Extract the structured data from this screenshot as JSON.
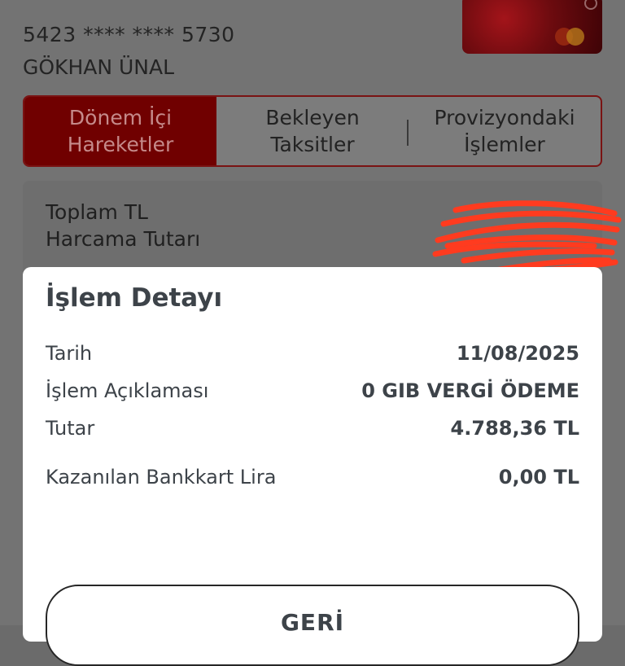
{
  "card": {
    "number": "5423 **** **** 5730",
    "holder": "GÖKHAN ÜNAL",
    "brand_icon": "mastercard-logo"
  },
  "tabs": [
    {
      "label": "Dönem İçi\nHareketler",
      "active": true
    },
    {
      "label": "Bekleyen\nTaksitler",
      "active": false
    },
    {
      "label": "Provizyondaki\nİşlemler",
      "active": false
    }
  ],
  "summary": {
    "label": "Toplam TL\nHarcama Tutarı"
  },
  "modal": {
    "title": "İşlem Detayı",
    "rows": [
      {
        "key": "Tarih",
        "value": "11/08/2025"
      },
      {
        "key": "İşlem Açıklaması",
        "value": "0 GIB VERGİ ÖDEME"
      },
      {
        "key": "Tutar",
        "value": "4.788,36 TL"
      },
      {
        "key": "Kazanılan Bankkart Lira",
        "value": "0,00 TL"
      }
    ],
    "back_label": "GERİ"
  },
  "colors": {
    "accent": "#700000",
    "overlay": "#737373",
    "text_dark": "#3d4349",
    "redaction": "#ff3b1f"
  }
}
